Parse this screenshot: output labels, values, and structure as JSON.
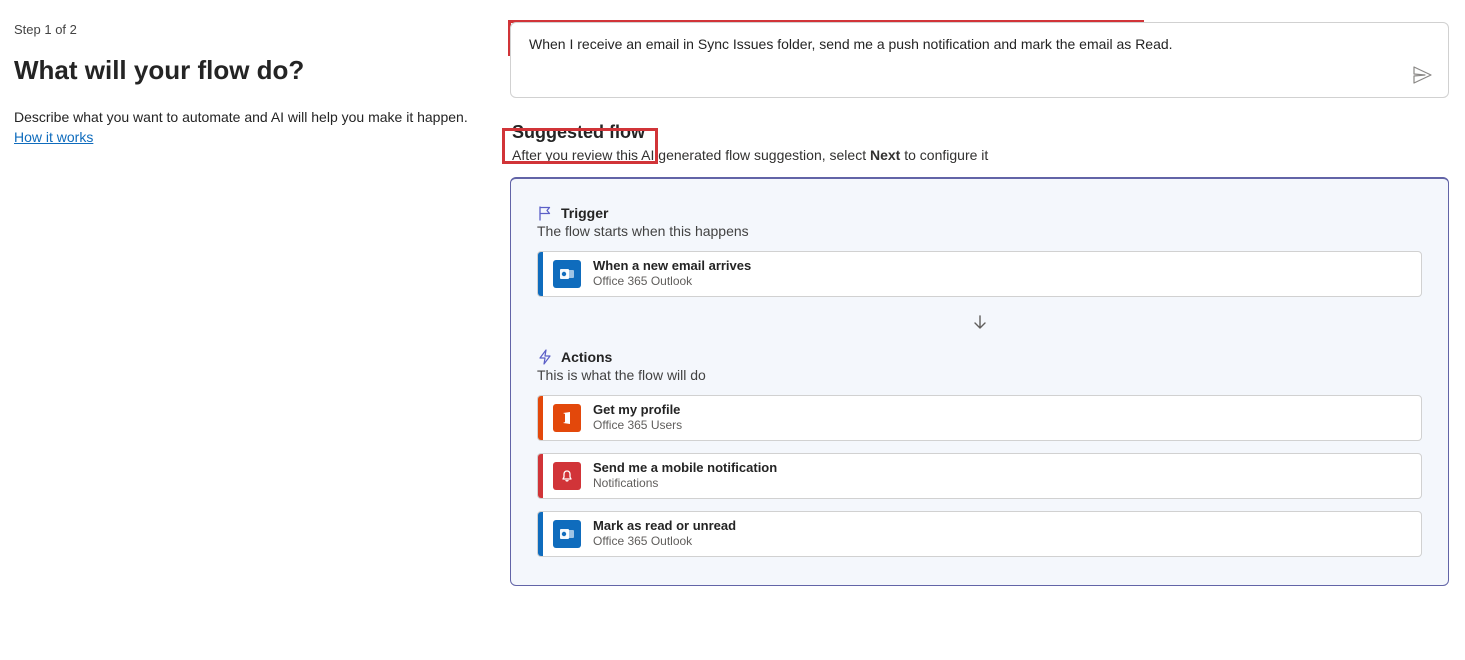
{
  "step": "Step 1 of 2",
  "heading": "What will your flow do?",
  "description": "Describe what you want to automate and AI will help you make it happen.",
  "how_link": "How it works",
  "prompt": "When I receive an email in Sync Issues folder, send me a push notification and mark the email as Read.",
  "suggested": {
    "title": "Suggested flow",
    "subtitle_pre": "After you review this AI generated flow suggestion, select ",
    "subtitle_bold": "Next",
    "subtitle_post": " to configure it"
  },
  "trigger": {
    "header": "Trigger",
    "sub": "The flow starts when this happens",
    "step": {
      "name": "When a new email arrives",
      "connector": "Office 365 Outlook"
    }
  },
  "actions": {
    "header": "Actions",
    "sub": "This is what the flow will do",
    "steps": [
      {
        "name": "Get my profile",
        "connector": "Office 365 Users"
      },
      {
        "name": "Send me a mobile notification",
        "connector": "Notifications"
      },
      {
        "name": "Mark as read or unread",
        "connector": "Office 365 Outlook"
      }
    ]
  }
}
